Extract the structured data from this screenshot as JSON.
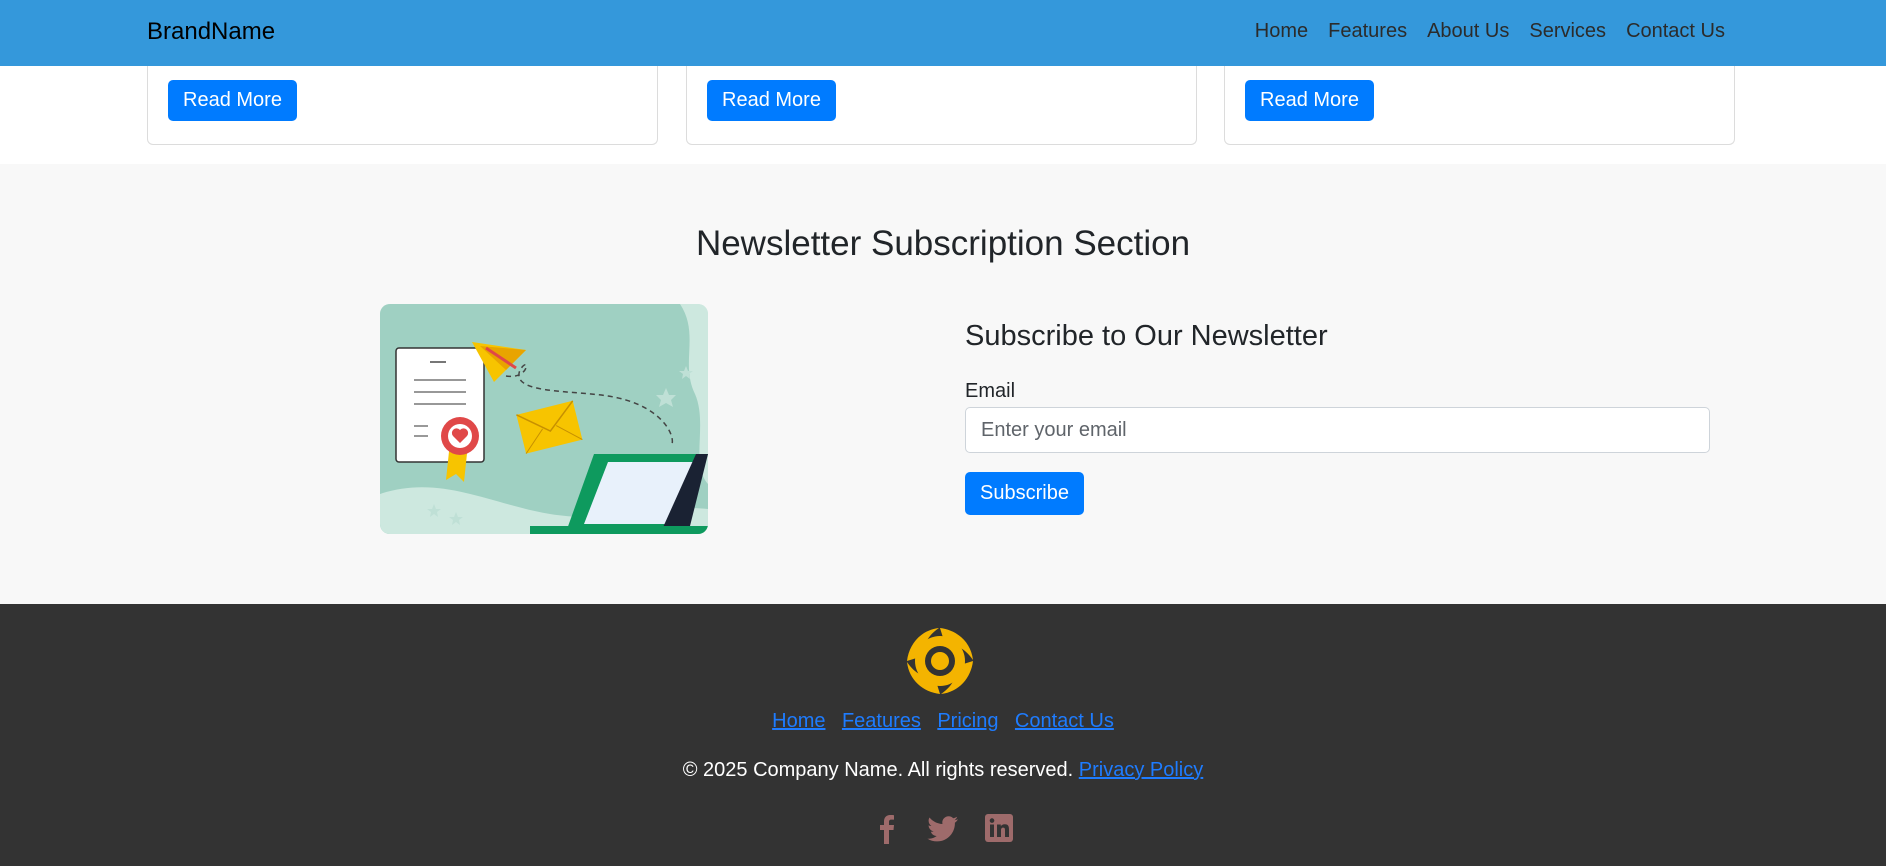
{
  "navbar": {
    "brand": "BrandName",
    "links": [
      "Home",
      "Features",
      "About Us",
      "Services",
      "Contact Us"
    ]
  },
  "cards": [
    {
      "button_label": "Read More"
    },
    {
      "button_label": "Read More"
    },
    {
      "button_label": "Read More"
    }
  ],
  "newsletter": {
    "section_heading": "Newsletter Subscription Section",
    "form_title": "Subscribe to Our Newsletter",
    "email_label": "Email",
    "email_placeholder": "Enter your email",
    "email_value": "",
    "subscribe_label": "Subscribe"
  },
  "footer": {
    "links": [
      "Home",
      "Features",
      "Pricing",
      "Contact Us"
    ],
    "copyright": "© 2025 Company Name. All rights reserved.",
    "privacy_label": "Privacy Policy",
    "socials": [
      "facebook-icon",
      "twitter-icon",
      "linkedin-icon"
    ]
  },
  "colors": {
    "navbar_bg": "#3498db",
    "button_primary": "#007bff",
    "footer_bg": "#333333",
    "footer_link": "#1e7cff",
    "social_icon": "#9e6b6b",
    "logo": "#f4b400"
  }
}
